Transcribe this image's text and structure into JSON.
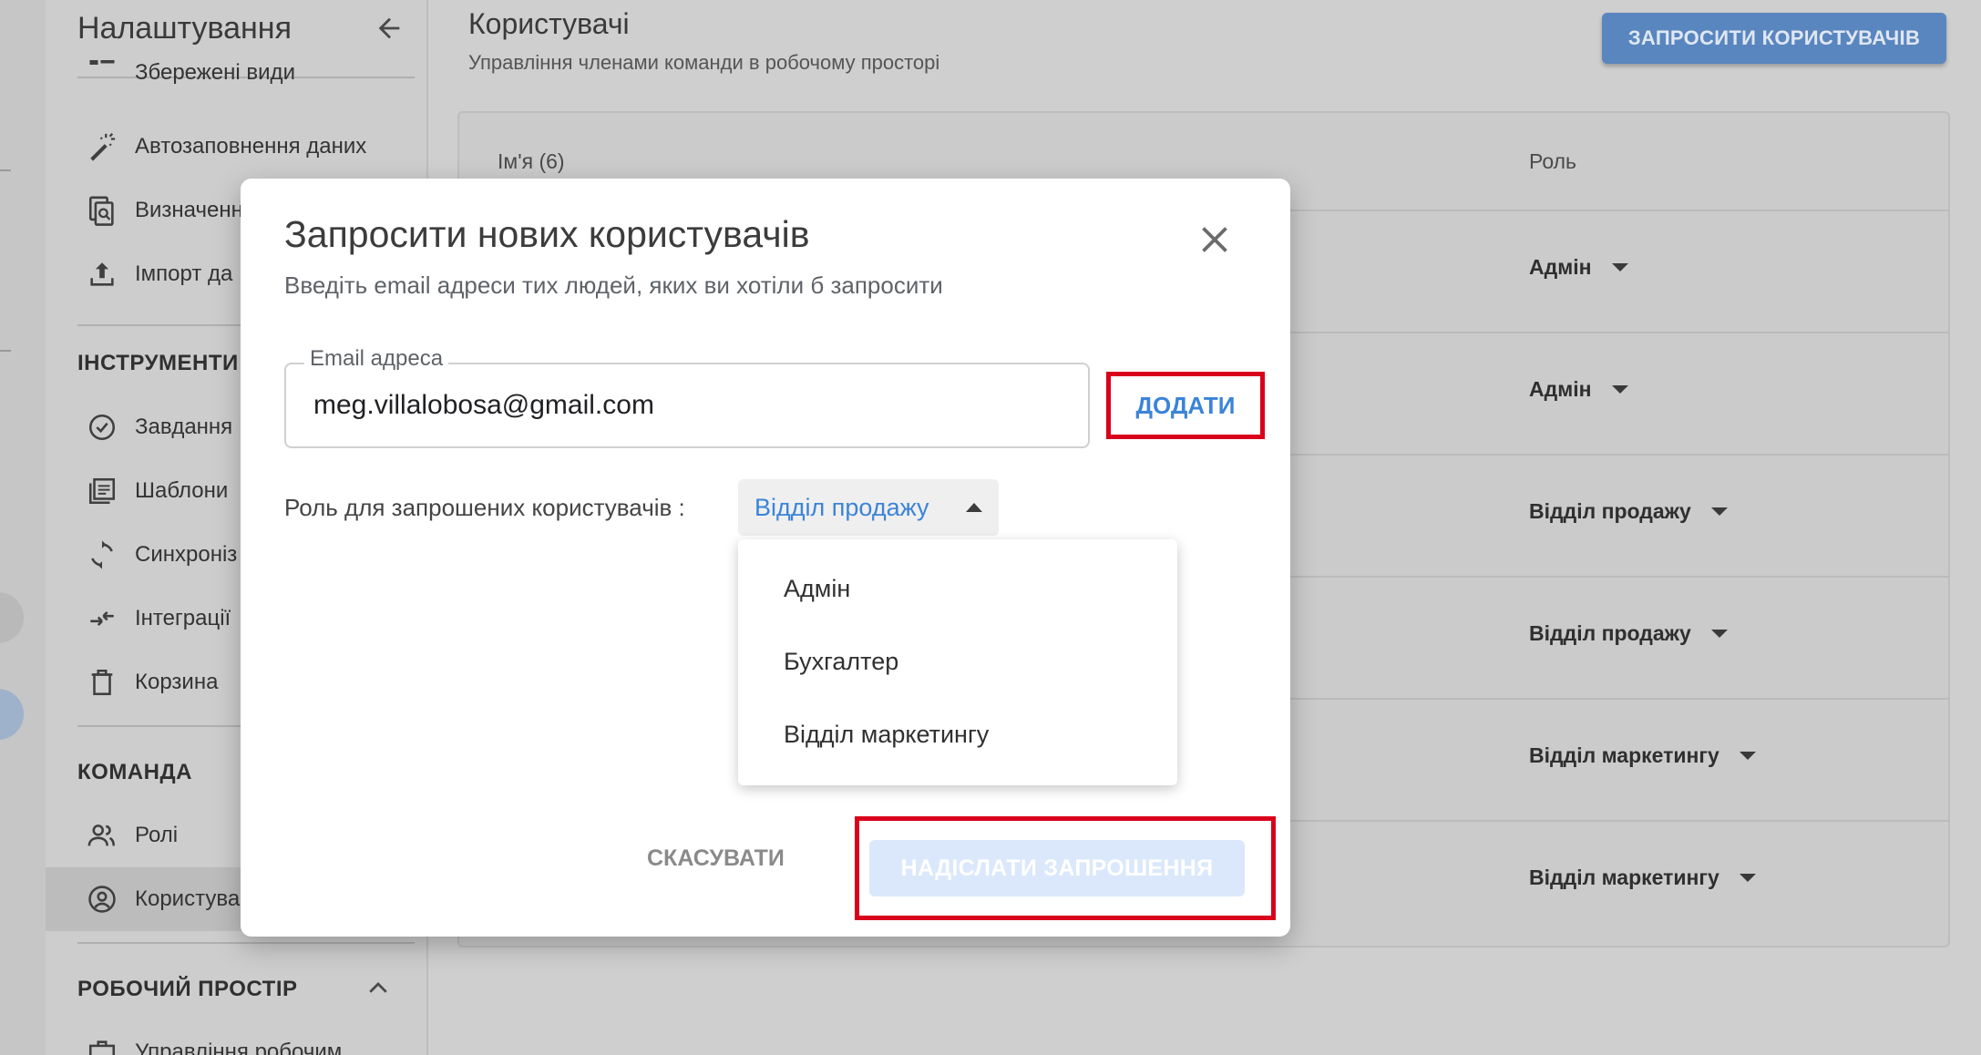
{
  "sidebar": {
    "title": "Налаштування",
    "items_top": [
      {
        "label": "Збережені види",
        "icon": "saved-views-icon"
      },
      {
        "label": "Автозаповнення даних",
        "icon": "magic-wand-icon"
      },
      {
        "label": "Визначенн",
        "icon": "definitions-icon"
      },
      {
        "label": "Імпорт да",
        "icon": "upload-icon"
      }
    ],
    "section_tools": "ІНСТРУМЕНТИ",
    "tools": [
      {
        "label": "Завдання",
        "icon": "check-circle-icon"
      },
      {
        "label": "Шаблони",
        "icon": "template-icon"
      },
      {
        "label": "Синхроніз",
        "icon": "sync-icon"
      },
      {
        "label": "Інтеграції",
        "icon": "integration-icon"
      },
      {
        "label": "Корзина",
        "icon": "trash-icon"
      }
    ],
    "section_team": "КОМАНДА",
    "team": [
      {
        "label": "Ролі",
        "icon": "roles-icon"
      },
      {
        "label": "Користува",
        "icon": "user-circle-icon"
      }
    ],
    "section_workspace": "РОБОЧИЙ ПРОСТІР",
    "workspace_item": "Управління робочим"
  },
  "main": {
    "title": "Користувачі",
    "subtitle": "Управління членами команди в робочому просторі",
    "invite_button": "ЗАПРОСИТИ КОРИСТУВАЧІВ",
    "table": {
      "col_name": "Ім'я (6)",
      "col_role": "Роль",
      "rows": [
        {
          "role": "Адмін"
        },
        {
          "role": "Адмін"
        },
        {
          "role": "Відділ продажу"
        },
        {
          "role": "Відділ продажу"
        },
        {
          "role": "Відділ маркетингу"
        },
        {
          "role": "Відділ маркетингу"
        }
      ]
    }
  },
  "modal": {
    "title": "Запросити нових користувачів",
    "subtitle": "Введіть email адреси тих людей, яких ви хотіли б запросити",
    "email_label": "Email адреса",
    "email_value": "meg.villalobosa@gmail.com",
    "add_button": "ДОДАТИ",
    "role_label": "Роль для запрошених користувачів :",
    "role_selected": "Відділ продажу",
    "role_options": [
      "Адмін",
      "Бухгалтер",
      "Відділ маркетингу"
    ],
    "cancel_button": "СКАСУВАТИ",
    "send_button": "НАДІСЛАТИ ЗАПРОШЕННЯ"
  },
  "colors": {
    "accent": "#3b84d8",
    "highlight": "#d9001b",
    "primary_button": "#5a86bf",
    "disabled_button": "#dbe8fb"
  }
}
